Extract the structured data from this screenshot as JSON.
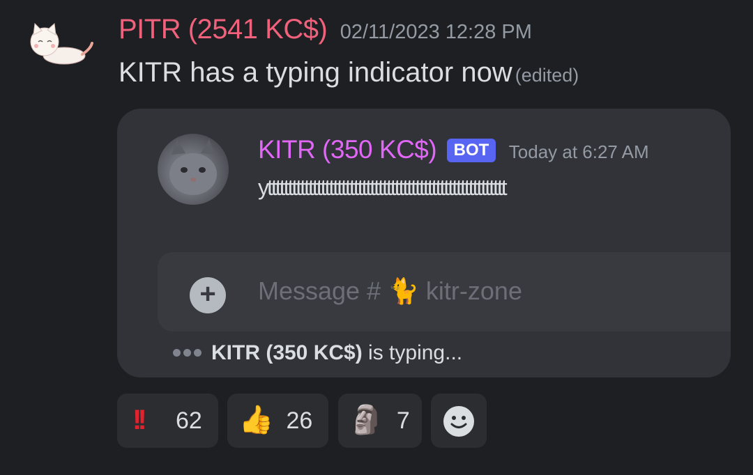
{
  "message": {
    "author": "PITR (2541 KC$)",
    "timestamp": "02/11/2023 12:28 PM",
    "text": "KITR has a typing indicator now",
    "edited_label": "(edited)"
  },
  "embed": {
    "bot_name": "KITR (350 KC$)",
    "bot_badge": "BOT",
    "bot_time": "Today at 6:27 AM",
    "bot_text": "ytttttttttttttttttttttttttttttttttttttttttttttttttttttttttt",
    "composer_placeholder": "Message # 🐈 kitr-zone",
    "typing_user": "KITR (350 KC$)",
    "typing_suffix": " is typing..."
  },
  "reactions": [
    {
      "emoji": "!!",
      "count": "62",
      "icon": "double-exclamation-icon"
    },
    {
      "emoji": "👍",
      "count": "26",
      "icon": "thumbs-up-icon"
    },
    {
      "emoji": "🗿",
      "count": "7",
      "icon": "moai-icon"
    },
    {
      "icon": "add-reaction-icon"
    }
  ],
  "colors": {
    "author": "#f0617c",
    "bot_name": "#e167f6",
    "badge": "#5865f2",
    "background": "#1e1f22"
  }
}
